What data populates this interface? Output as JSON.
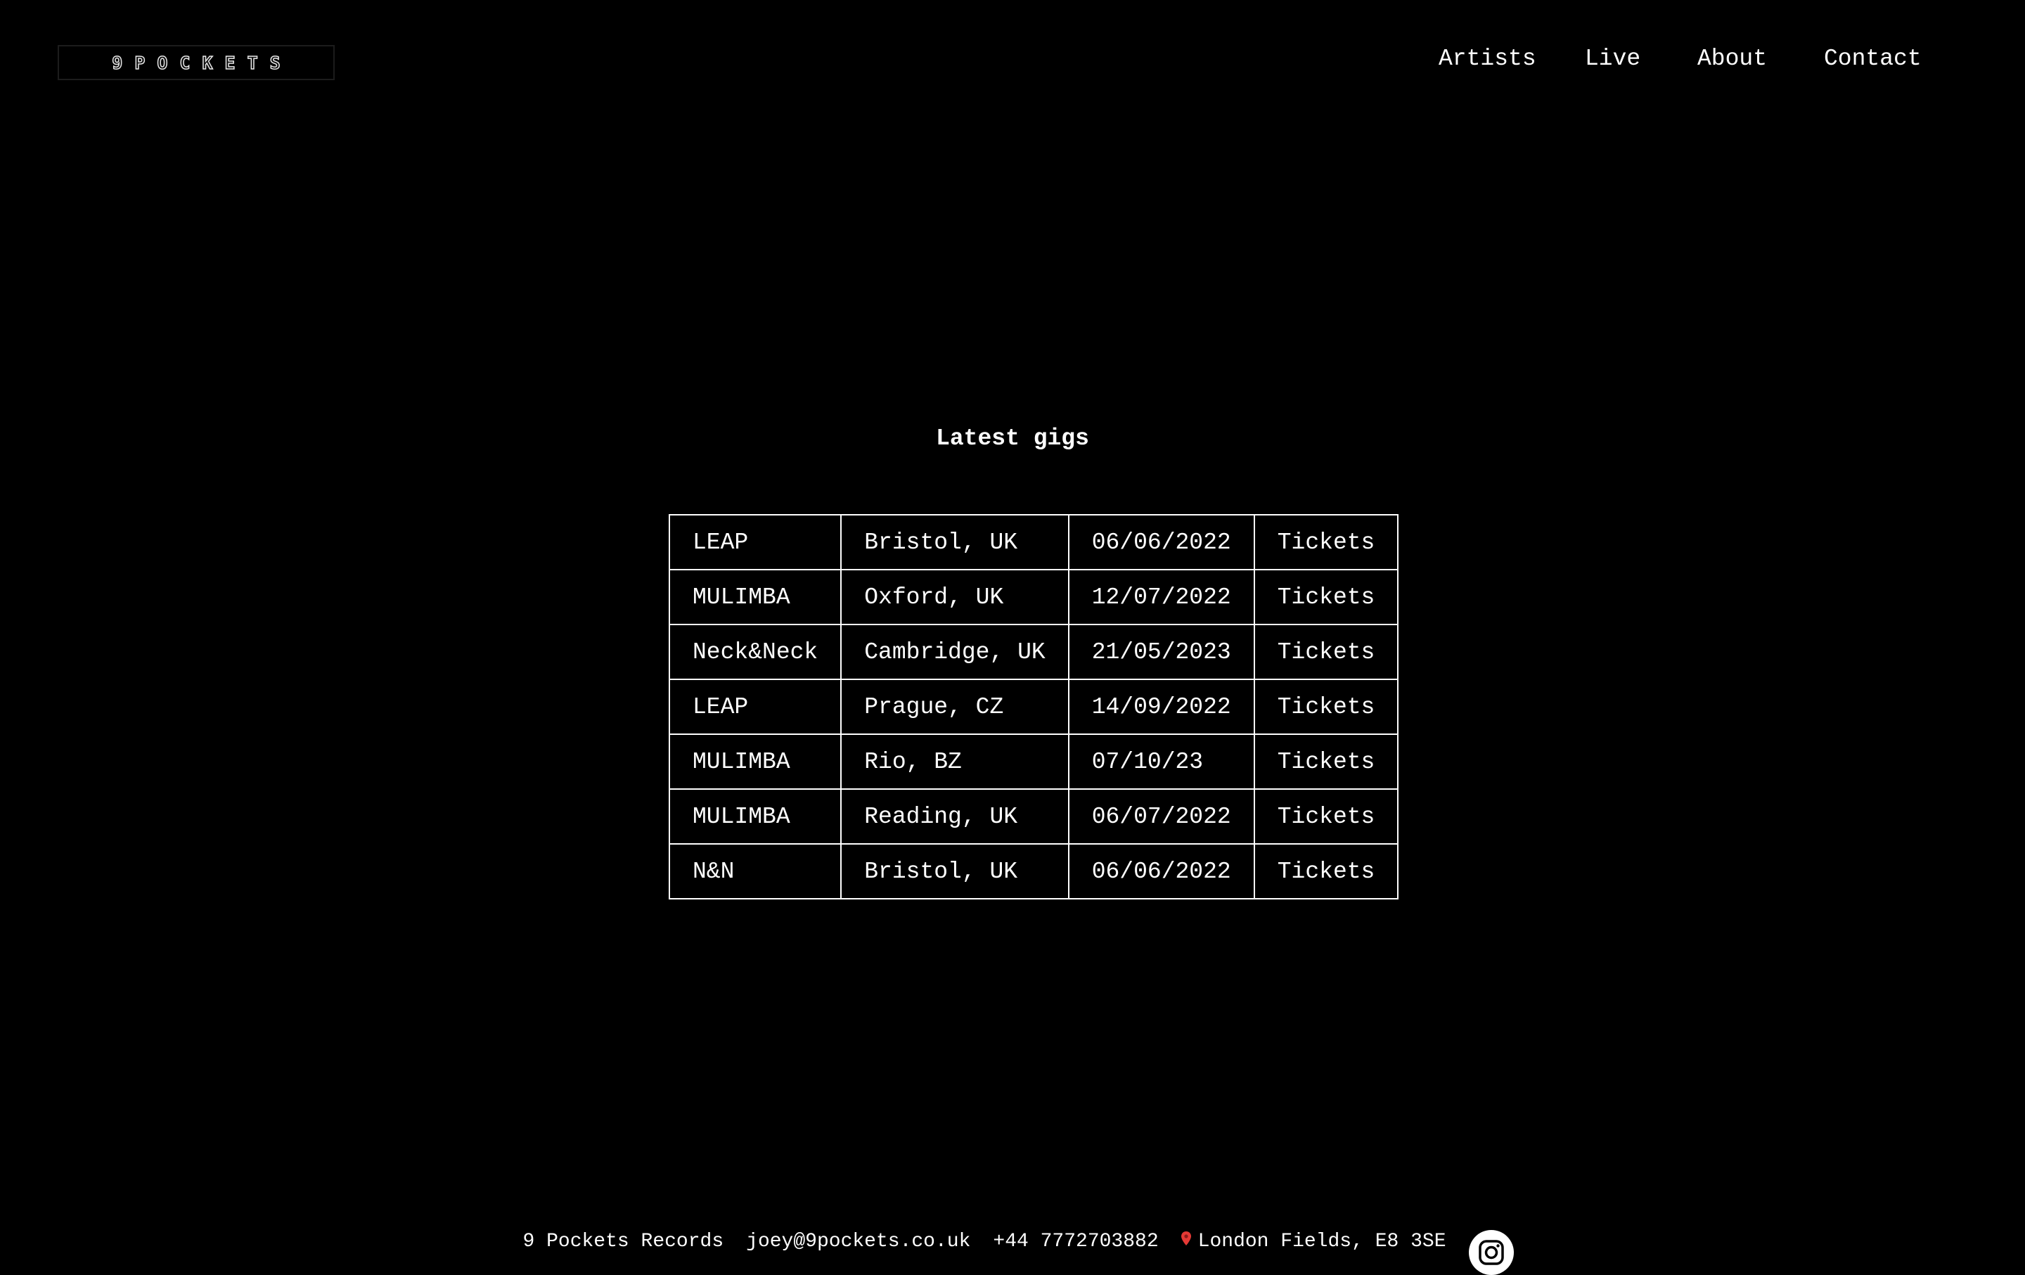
{
  "header": {
    "logo_text": "9POCKETS",
    "nav": {
      "artists": "Artists",
      "live": "Live",
      "about": "About",
      "contact": "Contact"
    }
  },
  "main": {
    "title": "Latest gigs",
    "gigs": [
      {
        "artist": "LEAP",
        "city": "Bristol, UK",
        "date": "06/06/2022",
        "tickets": "Tickets"
      },
      {
        "artist": "MULIMBA",
        "city": "Oxford, UK",
        "date": "12/07/2022",
        "tickets": "Tickets"
      },
      {
        "artist": "Neck&Neck",
        "city": "Cambridge, UK",
        "date": "21/05/2023",
        "tickets": "Tickets"
      },
      {
        "artist": "LEAP",
        "city": "Prague, CZ",
        "date": "14/09/2022",
        "tickets": "Tickets"
      },
      {
        "artist": "MULIMBA",
        "city": "Rio, BZ",
        "date": "07/10/23",
        "tickets": "Tickets"
      },
      {
        "artist": "MULIMBA",
        "city": "Reading, UK",
        "date": "06/07/2022",
        "tickets": "Tickets"
      },
      {
        "artist": "N&N",
        "city": "Bristol, UK",
        "date": "06/06/2022",
        "tickets": "Tickets"
      }
    ]
  },
  "footer": {
    "company": "9 Pockets Records",
    "email": "joey@9pockets.co.uk",
    "phone": "+44 7772703882",
    "address": "London Fields, E8 3SE",
    "icons": {
      "location": "map-pin-icon",
      "social": "instagram-icon"
    }
  },
  "colors": {
    "background": "#000000",
    "text": "#ffffff",
    "pin": "#e53935"
  }
}
